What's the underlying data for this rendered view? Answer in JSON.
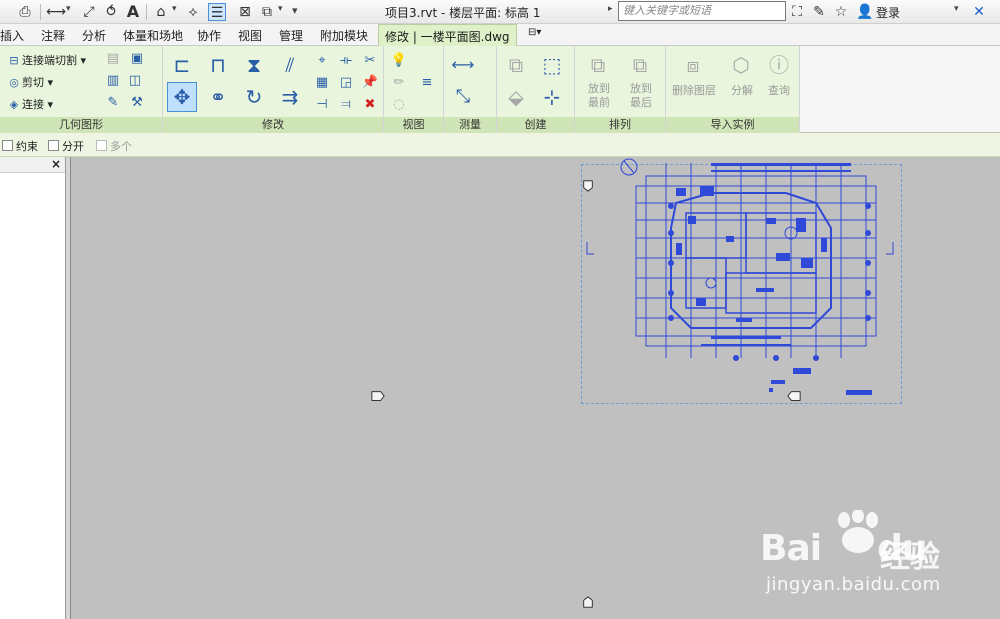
{
  "title_bar": {
    "document_title": "项目3.rvt - 楼层平面: 标高 1",
    "search_placeholder": "键入关键字或短语",
    "login_label": "登录"
  },
  "tabs": [
    {
      "label": "插入"
    },
    {
      "label": "注释"
    },
    {
      "label": "分析"
    },
    {
      "label": "体量和场地"
    },
    {
      "label": "协作"
    },
    {
      "label": "视图"
    },
    {
      "label": "管理"
    },
    {
      "label": "附加模块"
    },
    {
      "label": "修改 | 一楼平面图.dwg",
      "active": true
    }
  ],
  "ribbon": {
    "geometry": {
      "label": "几何图形",
      "cut_join_label": "连接端切割",
      "cut_label": "剪切",
      "join_label": "连接"
    },
    "modify": {
      "label": "修改"
    },
    "view": {
      "label": "视图"
    },
    "measure": {
      "label": "测量"
    },
    "create": {
      "label": "创建"
    },
    "arrange": {
      "label": "排列",
      "bring_front": "放到\n最前",
      "send_back": "放到\n最后"
    },
    "import_instance": {
      "label": "导入实例",
      "delete_layers": "删除图层",
      "explode": "分解",
      "query": "查询"
    }
  },
  "options_bar": {
    "constrain_label": "约束",
    "disjoin_label": "分开",
    "multiple_label": "多个"
  },
  "left_panel": {
    "close_glyph": "×"
  },
  "watermark": {
    "logo_text": "Bai",
    "logo_text_2": "du",
    "cn_text": "经验",
    "url": "jingyan.baidu.com"
  },
  "colors": {
    "accent_blue": "#2a5ea8",
    "context_tab_green": "#dff1c9",
    "canvas_gray": "#c0c0c0",
    "dwg_blue": "#2f49d8"
  }
}
